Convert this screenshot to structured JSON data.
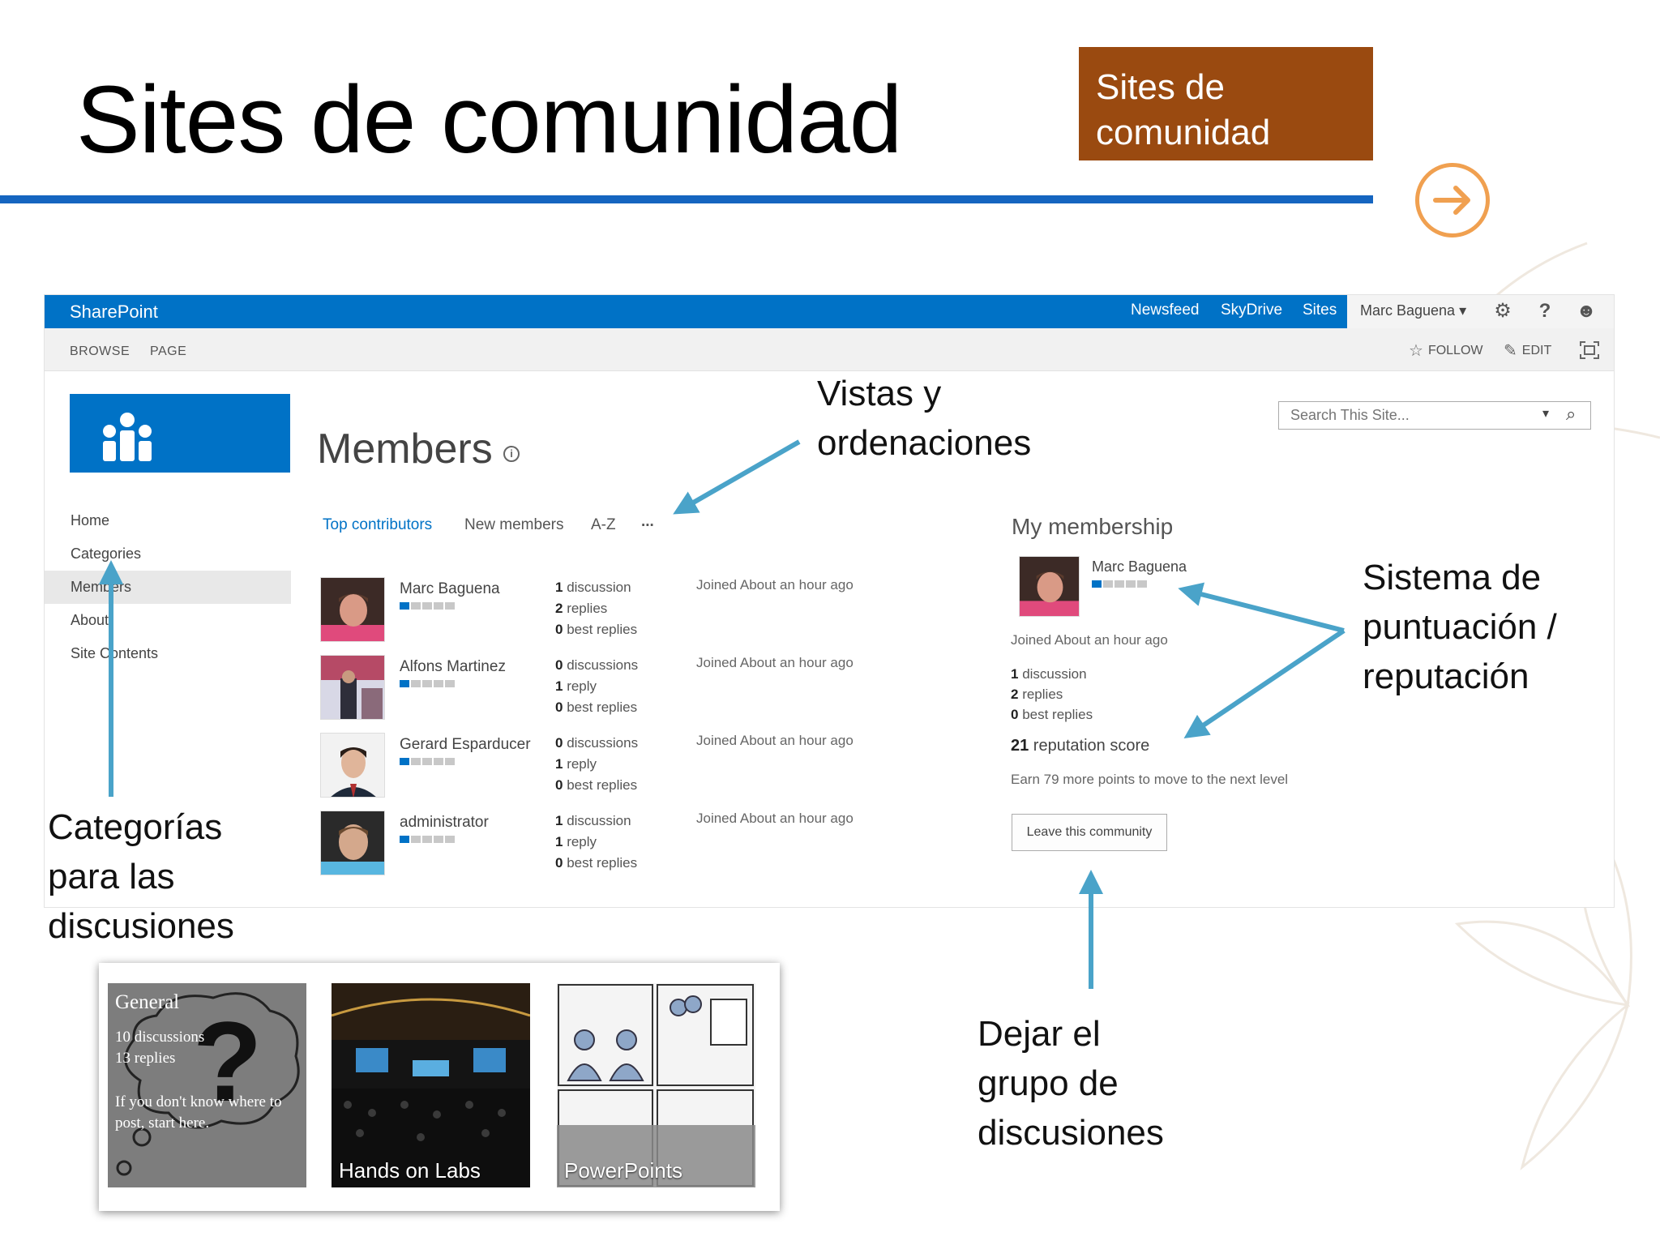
{
  "slide": {
    "title": "Sites de comunidad",
    "section_tag": "Sites de comunidad",
    "accent_color": "#1565c0",
    "tag_color": "#9a4a10",
    "next_icon": "arrow-right-circle-icon"
  },
  "sharepoint": {
    "brand": "SharePoint",
    "top_nav": [
      "Newsfeed",
      "SkyDrive",
      "Sites"
    ],
    "user": "Marc Baguena",
    "ribbon_tabs": [
      "BROWSE",
      "PAGE"
    ],
    "actions": {
      "follow": "FOLLOW",
      "edit": "EDIT"
    },
    "search_placeholder": "Search This Site...",
    "page_title": "Members",
    "left_nav": [
      "Home",
      "Categories",
      "Members",
      "About",
      "Site Contents"
    ],
    "views": [
      "Top contributors",
      "New members",
      "A-Z",
      "..."
    ],
    "members": [
      {
        "name": "Marc Baguena",
        "discussions": "1",
        "discussions_label": " discussion",
        "replies": "2",
        "replies_label": " replies",
        "best": "0",
        "best_label": " best replies",
        "joined": "Joined About an hour ago"
      },
      {
        "name": "Alfons Martinez",
        "discussions": "0",
        "discussions_label": " discussions",
        "replies": "1",
        "replies_label": " reply",
        "best": "0",
        "best_label": " best replies",
        "joined": "Joined About an hour ago"
      },
      {
        "name": "Gerard Esparducer",
        "discussions": "0",
        "discussions_label": " discussions",
        "replies": "1",
        "replies_label": " reply",
        "best": "0",
        "best_label": " best replies",
        "joined": "Joined About an hour ago"
      },
      {
        "name": "administrator",
        "discussions": "1",
        "discussions_label": " discussion",
        "replies": "1",
        "replies_label": " reply",
        "best": "0",
        "best_label": " best replies",
        "joined": "Joined About an hour ago"
      }
    ],
    "membership": {
      "title": "My membership",
      "name": "Marc Baguena",
      "joined": "Joined About an hour ago",
      "discussions": "1",
      "discussions_label": " discussion",
      "replies": "2",
      "replies_label": " replies",
      "best": "0",
      "best_label": " best replies",
      "score": "21",
      "score_label": " reputation score",
      "earn": "Earn 79 more points to move to the next level",
      "leave": "Leave this community"
    }
  },
  "annotations": {
    "views": [
      "Vistas y",
      "ordenaciones"
    ],
    "categories": [
      "Categorías",
      "para las",
      "discusiones"
    ],
    "reputation": [
      "Sistema de",
      "puntuación /",
      "reputación"
    ],
    "leave": [
      "Dejar el",
      "grupo de",
      "discusiones"
    ]
  },
  "tiles": {
    "general": {
      "name": "General",
      "discussions": "10 discussions",
      "replies": "13 replies",
      "desc1": "If you don't know where to",
      "desc2": "post, start here."
    },
    "labs": "Hands on Labs",
    "powerpoints": "PowerPoints"
  }
}
